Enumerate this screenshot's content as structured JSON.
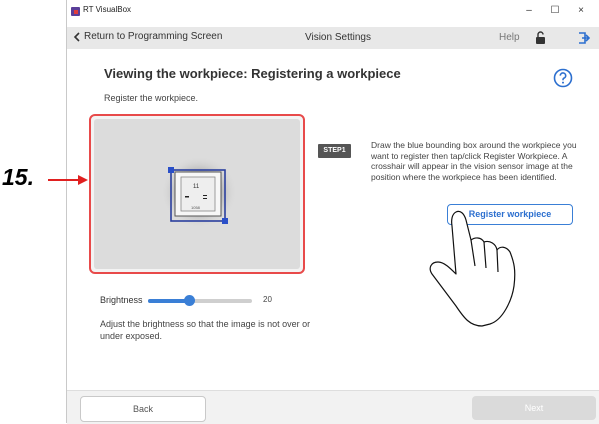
{
  "annotation": {
    "step_number": "15."
  },
  "window": {
    "app_title": "RT VisualBox",
    "controls": {
      "minimize": "–",
      "maximize": "☐",
      "close": "×"
    }
  },
  "nav": {
    "back_label": "Return to Programming Screen",
    "title": "Vision Settings",
    "help_label": "Help"
  },
  "main": {
    "heading": "Viewing the workpiece: Registering a workpiece",
    "subtext": "Register the workpiece.",
    "step_badge": "STEP1",
    "step_text": "Draw the blue bounding box around the workpiece you want to register then tap/click Register Workpiece. A crosshair will appear in the vision sensor image at the position where the workpiece has been identified.",
    "register_button": "Register workpiece"
  },
  "brightness": {
    "label": "Brightness",
    "value": "20",
    "level_fraction": 0.4,
    "hint": "Adjust the brightness so that the image is not over or under exposed."
  },
  "footer": {
    "back_label": "Back",
    "next_label": "Next"
  },
  "colors": {
    "accent": "#3a7fd6",
    "frame_highlight": "#e84a4a",
    "nav_bg": "#e8e8e8"
  }
}
